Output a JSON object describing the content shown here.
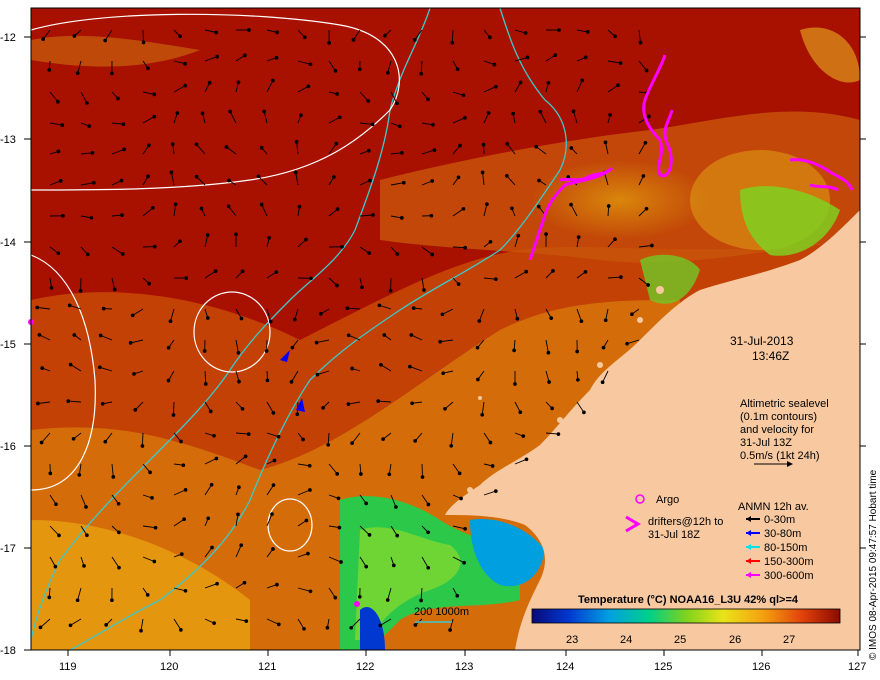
{
  "map": {
    "date": "31-Jul-2013",
    "time": "13:46Z",
    "altimetry_lines": [
      "Altimetric sealevel",
      "(0.1m contours)",
      "and velocity for",
      "31-Jul 13Z",
      "0.5m/s (1kt 24h)"
    ],
    "argo_label": "Argo",
    "drifters_lines": [
      "drifters@12h to",
      "31-Jul 18Z"
    ],
    "anmn_title": "ANMN 12h av.",
    "anmn_items": [
      {
        "label": "0-30m",
        "color": "#000000"
      },
      {
        "label": "30-80m",
        "color": "#0000ff"
      },
      {
        "label": "80-150m",
        "color": "#00e5e5"
      },
      {
        "label": "150-300m",
        "color": "#ff0000"
      },
      {
        "label": "300-600m",
        "color": "#ff00ff"
      }
    ],
    "depth_legend": "200  1000m",
    "colorbar_title": "Temperature (°C) NOAA16_L3U 42% ql>=4",
    "colorbar_ticks": [
      "23",
      "24",
      "25",
      "26",
      "27"
    ],
    "credit": "© IMOS 08-Apr-2015 09:47:57 Hobart time",
    "y_ticks": [
      "-12",
      "-13",
      "-14",
      "-15",
      "-16",
      "-17",
      "-18"
    ],
    "x_ticks": [
      "119",
      "120",
      "121",
      "122",
      "123",
      "124",
      "125",
      "126",
      "127"
    ],
    "colors": {
      "sea_hot": "#a81000",
      "sea_warm": "#c43a05",
      "sea_mid": "#d87c0a",
      "land": "#f8c9a0",
      "isobath": "#3ec8c8",
      "contour": "#ffffff",
      "drifter": "#ff00ff"
    }
  }
}
